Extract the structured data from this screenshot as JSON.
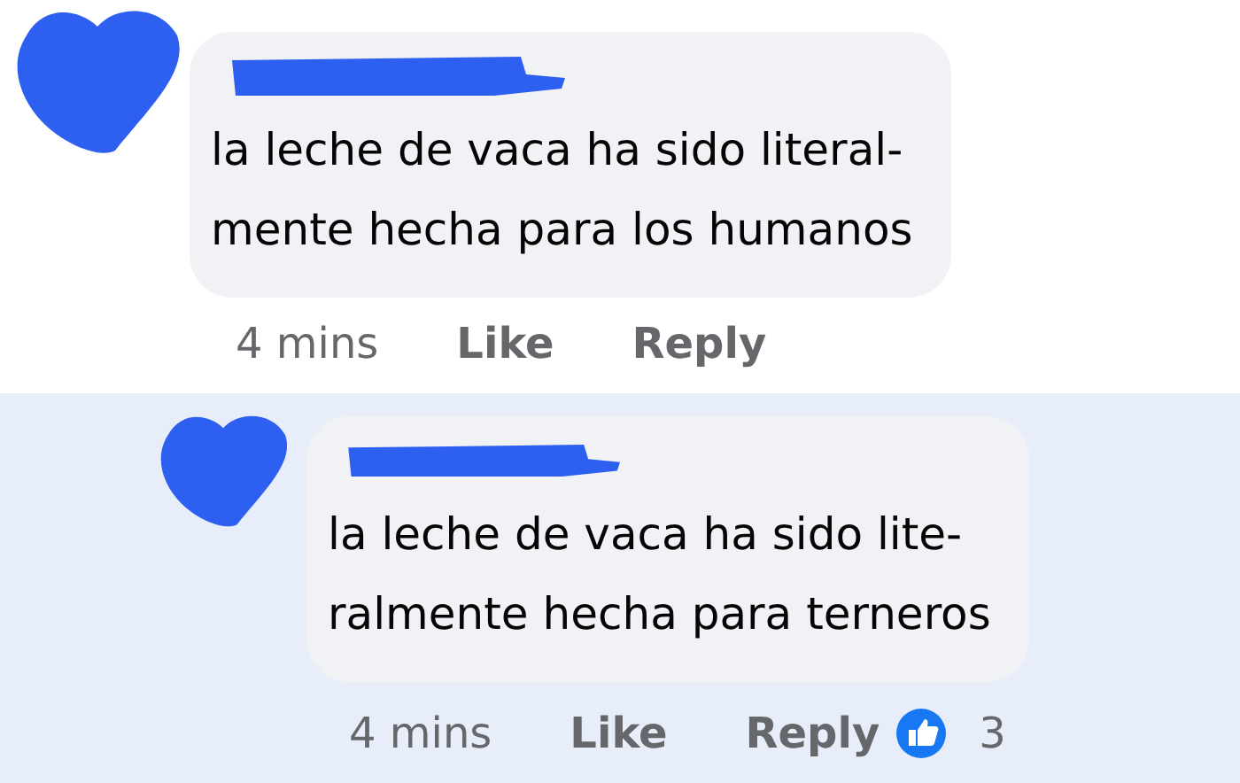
{
  "comments": [
    {
      "text_lines": [
        "la leche de vaca ha sido literal-",
        "mente hecha para los humanos"
      ],
      "time": "4 mins",
      "like": "Like",
      "reply": "Reply",
      "highlighted": false,
      "reply_level": false
    },
    {
      "text_lines": [
        "la leche de vaca ha sido lite-",
        "ralmente hecha para terneros"
      ],
      "time": "4 mins",
      "like": "Like",
      "reply": "Reply",
      "highlighted": true,
      "reply_level": true,
      "reaction_count": "3"
    }
  ]
}
